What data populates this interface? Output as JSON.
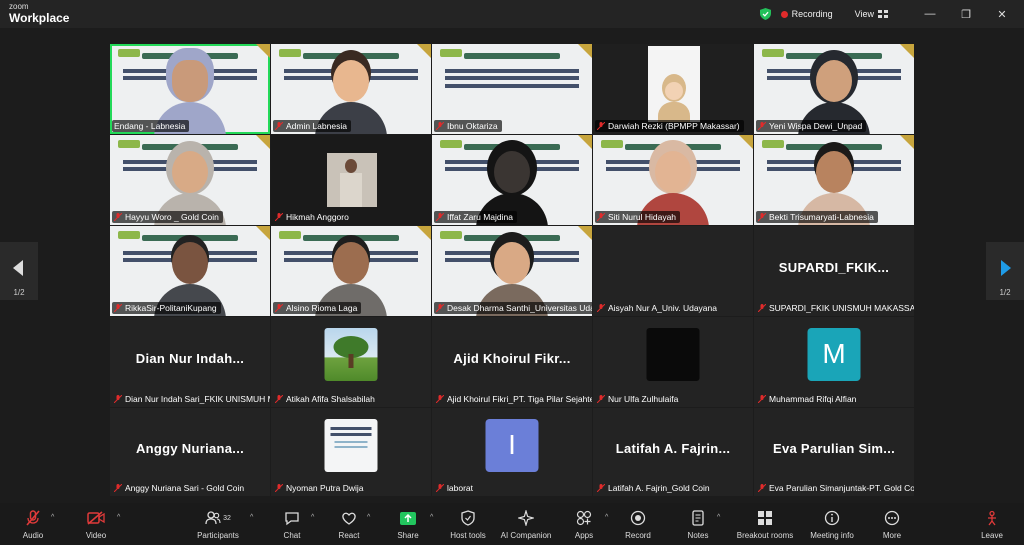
{
  "app": {
    "brand_top": "zoom",
    "brand_bottom": "Workplace"
  },
  "topbar": {
    "recording_label": "Recording",
    "view_label": "View",
    "window_buttons": [
      "—",
      "❐",
      "✕"
    ]
  },
  "colors": {
    "mic_muted": "#e02b2b",
    "active_speaker": "#23d959",
    "share_green": "#22c55e",
    "avatar_teal": "#1aa5b8",
    "avatar_purple": "#6b7fd8"
  },
  "pagination": {
    "left_page": "1/2",
    "right_page": "1/2"
  },
  "tiles": [
    {
      "name": "Endang - Labnesia",
      "muted": false,
      "kind": "slide"
    },
    {
      "name": "Admin Labnesia",
      "muted": true,
      "kind": "slide"
    },
    {
      "name": "Ibnu Oktariza",
      "muted": true,
      "kind": "slide"
    },
    {
      "name": "Darwiah Rezki (BPMPP Makassar)",
      "muted": true,
      "kind": "avatar-figure"
    },
    {
      "name": "Yeni Wispa Dewi_Unpad",
      "muted": true,
      "kind": "slide"
    },
    {
      "name": "Hayyu Woro _ Gold Coin",
      "muted": true,
      "kind": "slide"
    },
    {
      "name": "Hikmah Anggoro",
      "muted": true,
      "kind": "dark-photo"
    },
    {
      "name": "Iffat Zaru Majdina",
      "muted": true,
      "kind": "slide"
    },
    {
      "name": "Siti Nurul Hidayah",
      "muted": true,
      "kind": "slide"
    },
    {
      "name": "Bekti Trisumaryati-Labnesia",
      "muted": true,
      "kind": "slide"
    },
    {
      "name": "RikkaSir-PolitaniKupang",
      "muted": true,
      "kind": "slide"
    },
    {
      "name": "Alsino Rioma Laga",
      "muted": true,
      "kind": "slide"
    },
    {
      "name": "Desak Dharma Santhi_Universitas Udayana",
      "muted": true,
      "kind": "slide"
    },
    {
      "name": "Aisyah Nur A_Univ. Udayana",
      "muted": true,
      "kind": "empty"
    },
    {
      "name": "SUPARDI_FKIK UNISMUH MAKASSAR",
      "big": "SUPARDI_FKIK...",
      "muted": true,
      "kind": "bigname"
    },
    {
      "name": "Dian Nur Indah Sari_FKIK UNISMUH MAKASSAR",
      "big": "Dian Nur Indah...",
      "muted": true,
      "kind": "bigname"
    },
    {
      "name": "Atikah Afifa Shalsabilah",
      "muted": true,
      "kind": "tree"
    },
    {
      "name": "Ajid Khoirul Fikri_PT. Tiga Pilar Sejahtera",
      "big": "Ajid Khoirul Fikr...",
      "muted": true,
      "kind": "bigname"
    },
    {
      "name": "Nur Ulfa Zulhulaifa",
      "muted": true,
      "kind": "black-thumb"
    },
    {
      "name": "Muhammad Rifqi Alfian",
      "avatar": "M",
      "muted": true,
      "kind": "avatar-teal"
    },
    {
      "name": "Anggy Nuriana Sari - Gold Coin",
      "big": "Anggy Nuriana...",
      "muted": true,
      "kind": "bigname"
    },
    {
      "name": "Nyoman Putra Dwija",
      "muted": true,
      "kind": "slide-thumb"
    },
    {
      "name": "laborat",
      "avatar": "I",
      "muted": true,
      "kind": "avatar-purple"
    },
    {
      "name": "Latifah A. Fajrin_Gold Coin",
      "big": "Latifah A. Fajrin...",
      "muted": true,
      "kind": "bigname"
    },
    {
      "name": "Eva Parulian Simanjuntak-PT. Gold Coin",
      "big": "Eva Parulian Sim...",
      "muted": true,
      "kind": "bigname"
    }
  ],
  "toolbar": {
    "audio": "Audio",
    "video": "Video",
    "participants": "Participants",
    "participants_count": "32",
    "chat": "Chat",
    "react": "React",
    "share": "Share",
    "host_tools": "Host tools",
    "ai_companion": "AI Companion",
    "apps": "Apps",
    "record": "Record",
    "notes": "Notes",
    "breakout_rooms": "Breakout rooms",
    "meeting_info": "Meeting info",
    "more": "More",
    "leave": "Leave"
  }
}
